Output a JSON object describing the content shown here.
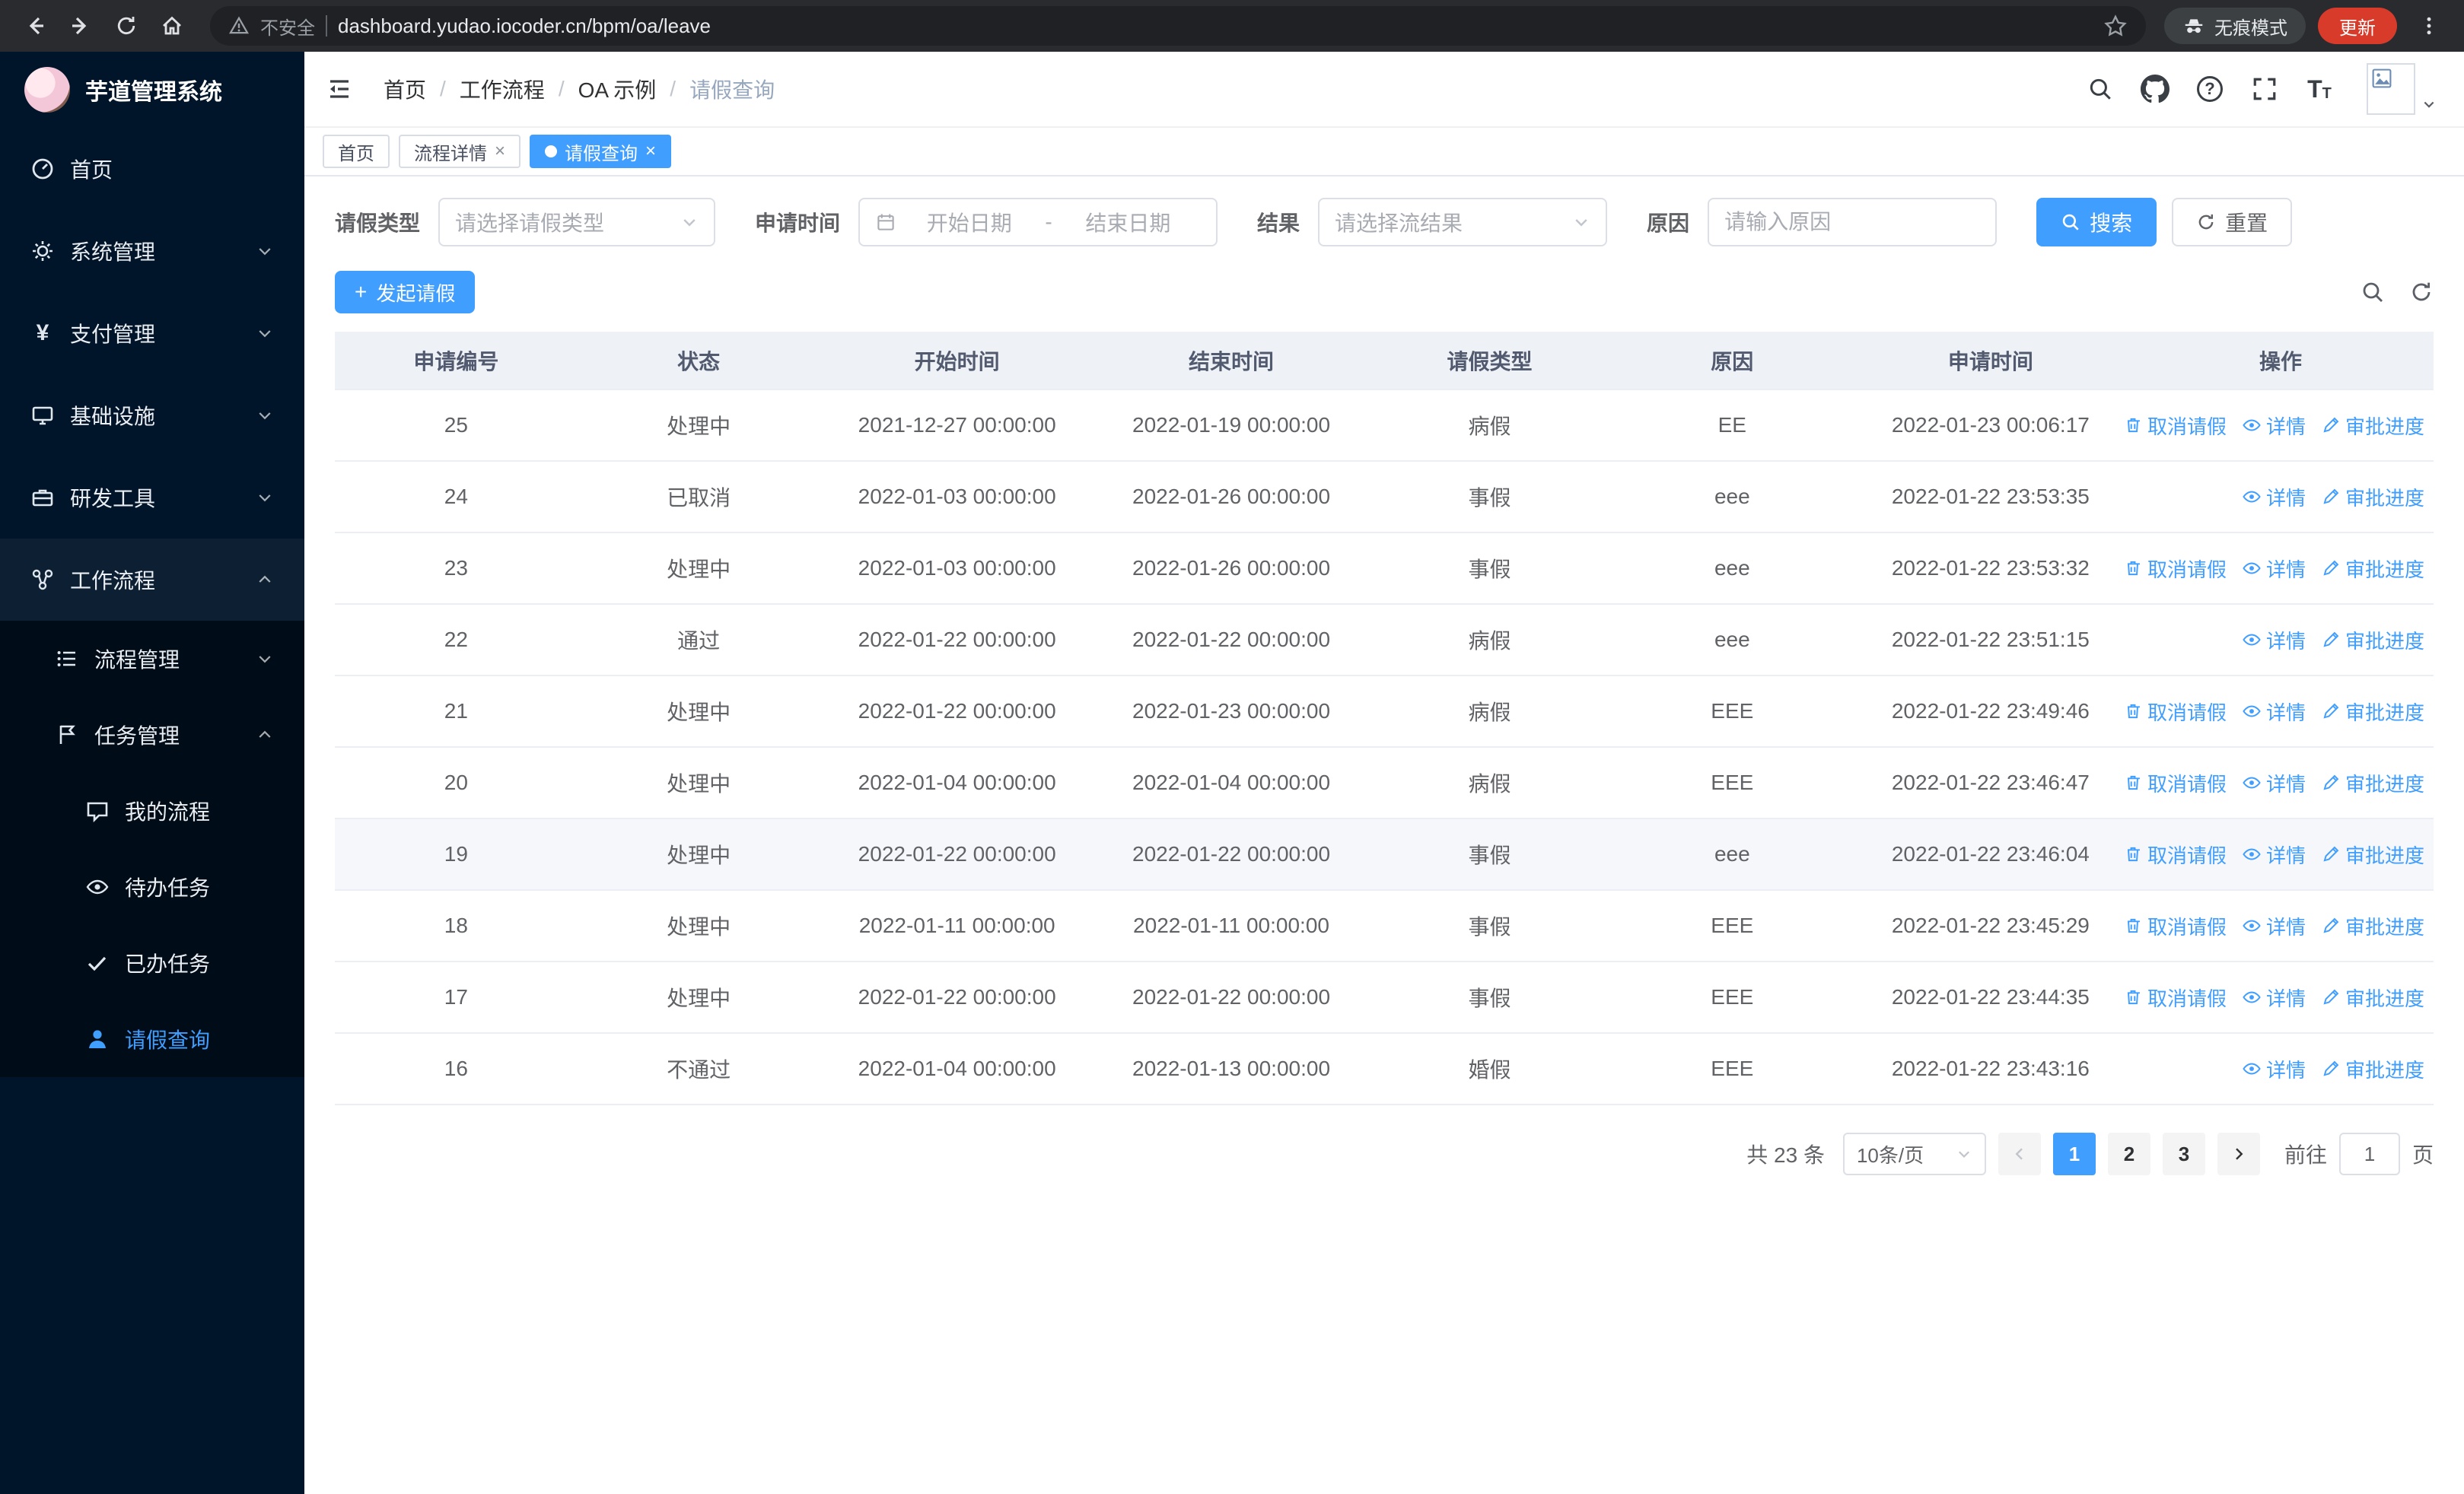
{
  "colors": {
    "accent": "#409eff",
    "sidebar_bg": "#001529",
    "table_header_bg": "#eef1f6"
  },
  "browser": {
    "security_label": "不安全",
    "url": "dashboard.yudao.iocoder.cn/bpm/oa/leave",
    "incognito_label": "无痕模式",
    "update_label": "更新"
  },
  "icons_glyphs": {
    "close": "×",
    "plus": "+",
    "yen": "¥",
    "help": "?",
    "font_large": "T",
    "font_small": "T"
  },
  "sidebar": {
    "title": "芋道管理系统",
    "items": [
      {
        "label": "首页",
        "icon": "dashboard"
      },
      {
        "label": "系统管理",
        "icon": "gear"
      },
      {
        "label": "支付管理",
        "icon": "yen"
      },
      {
        "label": "基础设施",
        "icon": "monitor"
      },
      {
        "label": "研发工具",
        "icon": "briefcase"
      },
      {
        "label": "工作流程",
        "icon": "workflow"
      }
    ],
    "workflow_children": [
      {
        "label": "流程管理",
        "icon": "list"
      },
      {
        "label": "任务管理",
        "icon": "flag"
      }
    ],
    "task_children": [
      {
        "label": "我的流程",
        "icon": "chat"
      },
      {
        "label": "待办任务",
        "icon": "eye"
      },
      {
        "label": "已办任务",
        "icon": "check"
      },
      {
        "label": "请假查询",
        "icon": "person"
      }
    ]
  },
  "header": {
    "breadcrumb": [
      "首页",
      "工作流程",
      "OA 示例",
      "请假查询"
    ],
    "separator": "/"
  },
  "tabs": [
    {
      "label": "首页"
    },
    {
      "label": "流程详情"
    },
    {
      "label": "请假查询"
    }
  ],
  "filters": {
    "leave_type_label": "请假类型",
    "leave_type_placeholder": "请选择请假类型",
    "apply_time_label": "申请时间",
    "start_placeholder": "开始日期",
    "range_separator": "-",
    "end_placeholder": "结束日期",
    "result_label": "结果",
    "result_placeholder": "请选择流结果",
    "reason_label": "原因",
    "reason_placeholder": "请输入原因",
    "search_label": "搜索",
    "reset_label": "重置"
  },
  "toolbar": {
    "create_label": "发起请假"
  },
  "table": {
    "columns": [
      "申请编号",
      "状态",
      "开始时间",
      "结束时间",
      "请假类型",
      "原因",
      "申请时间",
      "操作"
    ],
    "action_labels": {
      "cancel": "取消请假",
      "detail": "详情",
      "progress": "审批进度"
    },
    "rows": [
      {
        "id": "25",
        "status": "处理中",
        "start": "2021-12-27 00:00:00",
        "end": "2022-01-19 00:00:00",
        "type": "病假",
        "reason": "EE",
        "applied": "2022-01-23 00:06:17",
        "actions": [
          "cancel",
          "detail",
          "progress"
        ]
      },
      {
        "id": "24",
        "status": "已取消",
        "start": "2022-01-03 00:00:00",
        "end": "2022-01-26 00:00:00",
        "type": "事假",
        "reason": "eee",
        "applied": "2022-01-22 23:53:35",
        "actions": [
          "detail",
          "progress"
        ]
      },
      {
        "id": "23",
        "status": "处理中",
        "start": "2022-01-03 00:00:00",
        "end": "2022-01-26 00:00:00",
        "type": "事假",
        "reason": "eee",
        "applied": "2022-01-22 23:53:32",
        "actions": [
          "cancel",
          "detail",
          "progress"
        ]
      },
      {
        "id": "22",
        "status": "通过",
        "start": "2022-01-22 00:00:00",
        "end": "2022-01-22 00:00:00",
        "type": "病假",
        "reason": "eee",
        "applied": "2022-01-22 23:51:15",
        "actions": [
          "detail",
          "progress"
        ]
      },
      {
        "id": "21",
        "status": "处理中",
        "start": "2022-01-22 00:00:00",
        "end": "2022-01-23 00:00:00",
        "type": "病假",
        "reason": "EEE",
        "applied": "2022-01-22 23:49:46",
        "actions": [
          "cancel",
          "detail",
          "progress"
        ]
      },
      {
        "id": "20",
        "status": "处理中",
        "start": "2022-01-04 00:00:00",
        "end": "2022-01-04 00:00:00",
        "type": "病假",
        "reason": "EEE",
        "applied": "2022-01-22 23:46:47",
        "actions": [
          "cancel",
          "detail",
          "progress"
        ]
      },
      {
        "id": "19",
        "status": "处理中",
        "start": "2022-01-22 00:00:00",
        "end": "2022-01-22 00:00:00",
        "type": "事假",
        "reason": "eee",
        "applied": "2022-01-22 23:46:04",
        "actions": [
          "cancel",
          "detail",
          "progress"
        ]
      },
      {
        "id": "18",
        "status": "处理中",
        "start": "2022-01-11 00:00:00",
        "end": "2022-01-11 00:00:00",
        "type": "事假",
        "reason": "EEE",
        "applied": "2022-01-22 23:45:29",
        "actions": [
          "cancel",
          "detail",
          "progress"
        ]
      },
      {
        "id": "17",
        "status": "处理中",
        "start": "2022-01-22 00:00:00",
        "end": "2022-01-22 00:00:00",
        "type": "事假",
        "reason": "EEE",
        "applied": "2022-01-22 23:44:35",
        "actions": [
          "cancel",
          "detail",
          "progress"
        ]
      },
      {
        "id": "16",
        "status": "不通过",
        "start": "2022-01-04 00:00:00",
        "end": "2022-01-13 00:00:00",
        "type": "婚假",
        "reason": "EEE",
        "applied": "2022-01-22 23:43:16",
        "actions": [
          "detail",
          "progress"
        ]
      }
    ]
  },
  "pagination": {
    "total_text": "共 23 条",
    "page_size": "10条/页",
    "pages": [
      "1",
      "2",
      "3"
    ],
    "active_page": "1",
    "goto_label": "前往",
    "goto_value": "1",
    "goto_suffix": "页"
  }
}
